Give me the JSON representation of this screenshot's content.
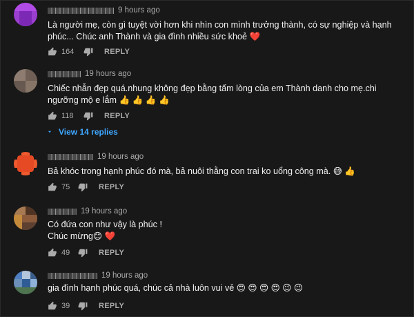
{
  "comments": [
    {
      "time": "9 hours ago",
      "text": "Là người mẹ, còn gì tuyệt vời hơn khi nhìn con mình trưởng thành, có sự nghiệp và hạnh phúc... Chúc anh Thành và gia đình nhiều sức khoẻ ❤️",
      "likes": "164",
      "reply": "REPLY",
      "avatar_color": "#9b3fd1"
    },
    {
      "time": "19 hours ago",
      "text": "Chiếc nhẫn đẹp quá.nhung không đẹp bằng tấm lòng của em Thành danh cho mẹ.chi ngưỡng mộ e lắm 👍 👍 👍 👍",
      "likes": "118",
      "reply": "REPLY",
      "view_replies": "View 14 replies",
      "avatar_color": "#7b6a5f"
    },
    {
      "time": "19 hours ago",
      "text": "Bả khóc trong hạnh phúc đó mà, bả nuôi thằng con trai ko uổng công mà. 😅 👍",
      "likes": "75",
      "reply": "REPLY",
      "avatar_color": "#ef5a2e"
    },
    {
      "time": "19 hours ago",
      "text": "Có đứa con như vậy là phúc !\nChúc mừng😊 ❤️",
      "likes": "49",
      "reply": "REPLY",
      "avatar_color": "#8a5a3a"
    },
    {
      "time": "19 hours ago",
      "text": "gia đình hạnh phúc quá, chúc cả nhà luôn vui vẻ 😍 😍 😍 😍 😉 😉",
      "likes": "39",
      "reply": "REPLY",
      "avatar_color": "#4f7fc0"
    }
  ],
  "colors": {
    "background": "#181818",
    "text": "#f1f1f1",
    "secondary_text": "#aaaaaa",
    "link": "#3ea6ff"
  },
  "icons": {
    "like": "thumbs-up-icon",
    "dislike": "thumbs-down-icon",
    "expand": "chevron-down-icon"
  }
}
